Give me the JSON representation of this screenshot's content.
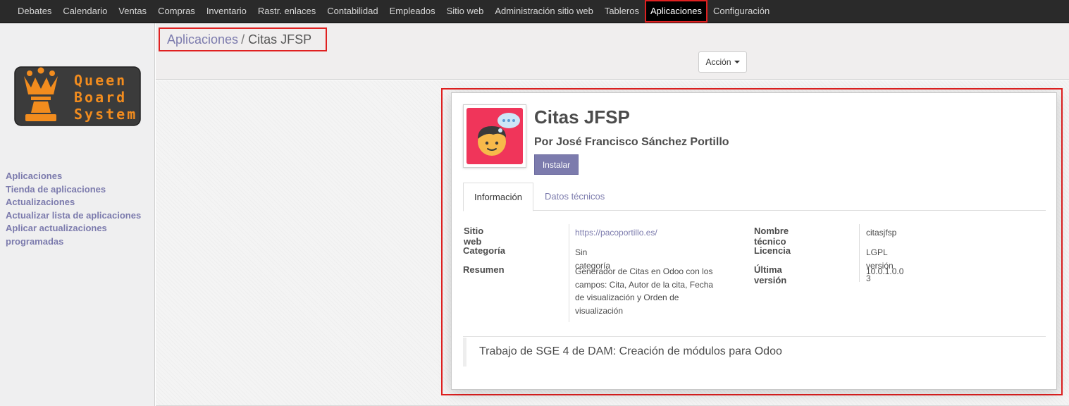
{
  "topnav": {
    "items": [
      "Debates",
      "Calendario",
      "Ventas",
      "Compras",
      "Inventario",
      "Rastr. enlaces",
      "Contabilidad",
      "Empleados",
      "Sitio web",
      "Administración sitio web",
      "Tableros",
      "Aplicaciones",
      "Configuración"
    ],
    "active": "Aplicaciones"
  },
  "logo": {
    "lines": [
      "Queen",
      "Board",
      "System"
    ]
  },
  "sidebar": {
    "items": [
      "Aplicaciones",
      "Tienda de aplicaciones",
      "Actualizaciones",
      "Actualizar lista de aplicaciones",
      "Aplicar actualizaciones",
      "programadas"
    ]
  },
  "breadcrumb": {
    "parent": "Aplicaciones",
    "separator": "/",
    "current": "Citas JFSP"
  },
  "toolbar": {
    "action_label": "Acción"
  },
  "module": {
    "name": "Citas JFSP",
    "author": "Por José Francisco Sánchez Portillo",
    "install_label": "Instalar",
    "tabs": [
      "Información",
      "Datos técnicos"
    ],
    "left_fields": {
      "website_label": "Sitio web",
      "website_value": "https://pacoportillo.es/",
      "category_label": "Categoría",
      "category_value": "Sin categoría",
      "summary_label": "Resumen",
      "summary_lines": [
        "Generador de Citas en Odoo con los",
        "campos: Cita, Autor de la cita, Fecha",
        "de visualización y Orden de",
        "visualización"
      ]
    },
    "right_fields": {
      "technical_name_label": "Nombre técnico",
      "technical_name_value": "citasjfsp",
      "license_label": "Licencia",
      "license_value": "LGPL versión 3",
      "version_label": "Última versión",
      "version_value": "10.0.1.0.0"
    },
    "description": "Trabajo de SGE 4 de DAM: Creación de módulos para Odoo"
  },
  "colors": {
    "accent": "#7c7bad",
    "topbar": "#2a2a2a",
    "highlight": "#e02020",
    "icon_background": "#f0355a",
    "logo_orange": "#f28c1e"
  }
}
